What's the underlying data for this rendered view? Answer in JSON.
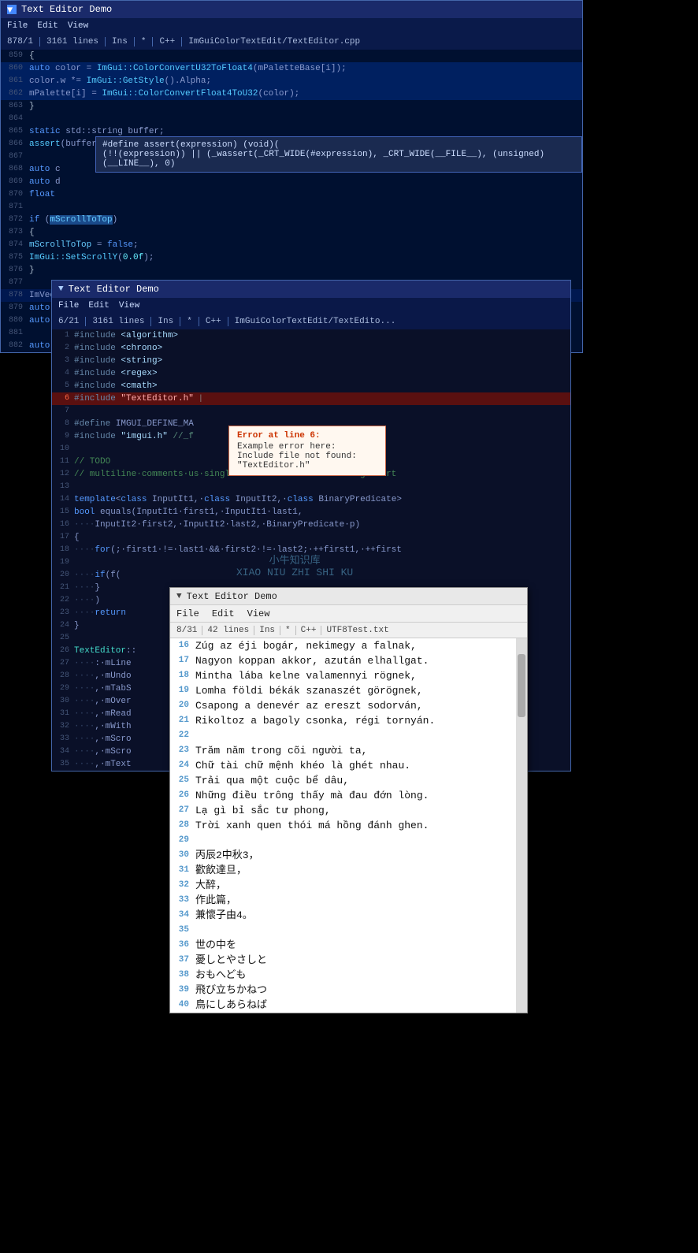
{
  "window1": {
    "title": "Text Editor Demo",
    "menu": [
      "File",
      "Edit",
      "View"
    ],
    "status": {
      "position": "878/1",
      "lines": "3161 lines",
      "mode": "Ins",
      "flag1": "*",
      "lang": "C++",
      "file": "ImGuiColorTextEdit/TextEditor.cpp"
    },
    "code_lines": [
      {
        "ln": "859",
        "code": "        {"
      },
      {
        "ln": "860",
        "code": "            auto color = ImGui::ColorConvertU32ToFloat4(mPaletteBase[i]);"
      },
      {
        "ln": "861",
        "code": "            color.w *= ImGui::GetStyle().Alpha;"
      },
      {
        "ln": "862",
        "code": "            mPalette[i] = ImGui::ColorConvertFloat4ToU32(color);"
      },
      {
        "ln": "863",
        "code": "        }"
      },
      {
        "ln": "864",
        "code": ""
      },
      {
        "ln": "865",
        "code": "        static std::string buffer;"
      },
      {
        "ln": "866",
        "code": "        assert(buffer.empty());"
      },
      {
        "ln": "867",
        "code": ""
      },
      {
        "ln": "868",
        "code": "        auto c"
      },
      {
        "ln": "869",
        "code": "        auto d"
      },
      {
        "ln": "870",
        "code": "        float"
      },
      {
        "ln": "871",
        "code": ""
      },
      {
        "ln": "872",
        "code": "        if (mScrollToTop)"
      },
      {
        "ln": "873",
        "code": "        {"
      },
      {
        "ln": "874",
        "code": "            mScrollToTop = false;"
      },
      {
        "ln": "875",
        "code": "            ImGui::SetScrollY(0.0f);"
      },
      {
        "ln": "876",
        "code": "        }"
      },
      {
        "ln": "877",
        "code": ""
      },
      {
        "ln": "878",
        "code": "        ImVec2 cursorScreenPos = ImGui::GetCursorScreenPos();"
      },
      {
        "ln": "879",
        "code": "        auto scrollX = ImGui::GetScrollX();"
      },
      {
        "ln": "880",
        "code": "        auto scrollY = ImGui::GetScrollY();"
      },
      {
        "ln": "881",
        "code": ""
      },
      {
        "ln": "882",
        "code": "        auto lineNo = (int)floor(scrollY / mCharAdvance.y);"
      }
    ],
    "tooltip": "#define assert(expression) (void)((!!(expression)) || (_wassert(_CRT_WIDE(#expression), _CRT_WIDE(__FILE__), (unsigned)(__LINE__), 0)"
  },
  "window2": {
    "title": "Text Editor Demo",
    "menu": [
      "File",
      "Edit",
      "View"
    ],
    "status": {
      "position": "6/21",
      "lines": "3161 lines",
      "mode": "Ins",
      "flag1": "*",
      "lang": "C++",
      "file": "ImGuiColorTextEdit/TextEdito..."
    },
    "code_lines": [
      {
        "ln": "1",
        "code": "#include <algorithm>"
      },
      {
        "ln": "2",
        "code": "#include <chrono>"
      },
      {
        "ln": "3",
        "code": "#include <string>"
      },
      {
        "ln": "4",
        "code": "#include <regex>"
      },
      {
        "ln": "5",
        "code": "#include <cmath>"
      },
      {
        "ln": "6",
        "code": "#include \"TextEditor.h\"",
        "error": true
      },
      {
        "ln": "7",
        "code": ""
      },
      {
        "ln": "8",
        "code": "#define IMGUI_DEFINE_MA"
      },
      {
        "ln": "9",
        "code": "#include \"imgui.h\" //_f"
      },
      {
        "ln": "10",
        "code": ""
      },
      {
        "ln": "11",
        "code": "// TODO"
      },
      {
        "ln": "12",
        "code": "// multiline comments us single-line: latter is blocking start"
      },
      {
        "ln": "13",
        "code": ""
      },
      {
        "ln": "14",
        "code": "template<class InputIt1, class InputIt2, class BinaryPredicate>"
      },
      {
        "ln": "15",
        "code": "bool equals(InputIt1 first1, InputIt1 last1,"
      },
      {
        "ln": "16",
        "code": "    InputIt2 first2, InputIt2 last2, BinaryPredicate p)"
      },
      {
        "ln": "17",
        "code": "{"
      },
      {
        "ln": "18",
        "code": "    for (; first1 != last1 && first2 != last2; ++first1, ++first"
      },
      {
        "ln": "19",
        "code": ""
      },
      {
        "ln": "20",
        "code": "    if (f("
      },
      {
        "ln": "21",
        "code": "    }"
      },
      {
        "ln": "22",
        "code": "    )"
      },
      {
        "ln": "23",
        "code": "    return"
      },
      {
        "ln": "24",
        "code": "}"
      },
      {
        "ln": "25",
        "code": ""
      },
      {
        "ln": "26",
        "code": "TextEditor::"
      },
      {
        "ln": "27",
        "code": "    : mLine"
      },
      {
        "ln": "28",
        "code": "    , mUndo"
      },
      {
        "ln": "29",
        "code": "    , mTabS"
      },
      {
        "ln": "30",
        "code": "    , mOver"
      },
      {
        "ln": "31",
        "code": "    , mRead"
      },
      {
        "ln": "32",
        "code": "    , mWith"
      },
      {
        "ln": "33",
        "code": "    , mScro"
      },
      {
        "ln": "34",
        "code": "    , mScro"
      },
      {
        "ln": "35",
        "code": "    , mText"
      }
    ],
    "error_popup": {
      "title": "Error at line 6:",
      "line1": "Example error here:",
      "line2": "Include file not found: \"TextEditor.h\""
    }
  },
  "window3": {
    "title": "Text Editor Demo",
    "menu": [
      "File",
      "Edit",
      "View"
    ],
    "status": {
      "position": "8/31",
      "lines": "42 lines",
      "mode": "Ins",
      "flag1": "*",
      "lang": "C++",
      "file": "UTF8Test.txt"
    },
    "lines": [
      {
        "ln": "16",
        "text": "Zúg az éji bogár, nekimegy a falnak,"
      },
      {
        "ln": "17",
        "text": "Nagyon koppan akkor, azután elhallgat."
      },
      {
        "ln": "18",
        "text": "Mintha lába kelne valamennyi rögnek,"
      },
      {
        "ln": "19",
        "text": "Lomha földi békák szanaszét görögnek,"
      },
      {
        "ln": "20",
        "text": "Csapong a denevér az ereszt sodorván,"
      },
      {
        "ln": "21",
        "text": "Rikoltoz a bagoly csonka, régi tornyán."
      },
      {
        "ln": "22",
        "text": ""
      },
      {
        "ln": "23",
        "text": "Trăm năm trong cõi người ta,"
      },
      {
        "ln": "24",
        "text": "Chữ tài chữ mệnh khéo là ghét nhau."
      },
      {
        "ln": "25",
        "text": "Trải qua một cuộc bể dâu,"
      },
      {
        "ln": "26",
        "text": "Những điều trông thấy mà đau đớn lòng."
      },
      {
        "ln": "27",
        "text": "Lạ gì bỉ sắc tư phong,"
      },
      {
        "ln": "28",
        "text": "Trời xanh quen thói má hồng đánh ghen."
      },
      {
        "ln": "29",
        "text": ""
      },
      {
        "ln": "30",
        "text": "丙辰2中秋3，"
      },
      {
        "ln": "31",
        "text": "歡飲達旦，"
      },
      {
        "ln": "32",
        "text": "大醉，"
      },
      {
        "ln": "33",
        "text": "作此篇，"
      },
      {
        "ln": "34",
        "text": "兼懷子由4。"
      },
      {
        "ln": "35",
        "text": ""
      },
      {
        "ln": "36",
        "text": "世の中を"
      },
      {
        "ln": "37",
        "text": "憂しとやさしと"
      },
      {
        "ln": "38",
        "text": "おもへども"
      },
      {
        "ln": "39",
        "text": "飛び立ちかねつ"
      },
      {
        "ln": "40",
        "text": "鳥にしあらねば"
      }
    ]
  },
  "watermark": {
    "line1": "小牛知识库",
    "line2": "XIAO NIU ZHI SHI KU"
  },
  "labels": {
    "file": "File",
    "edit": "Edit",
    "view": "View",
    "error_title": "Error at line 6:",
    "error_line1": "Example error here:",
    "error_line2": "Include file not found: \"TextEditor.h\""
  }
}
